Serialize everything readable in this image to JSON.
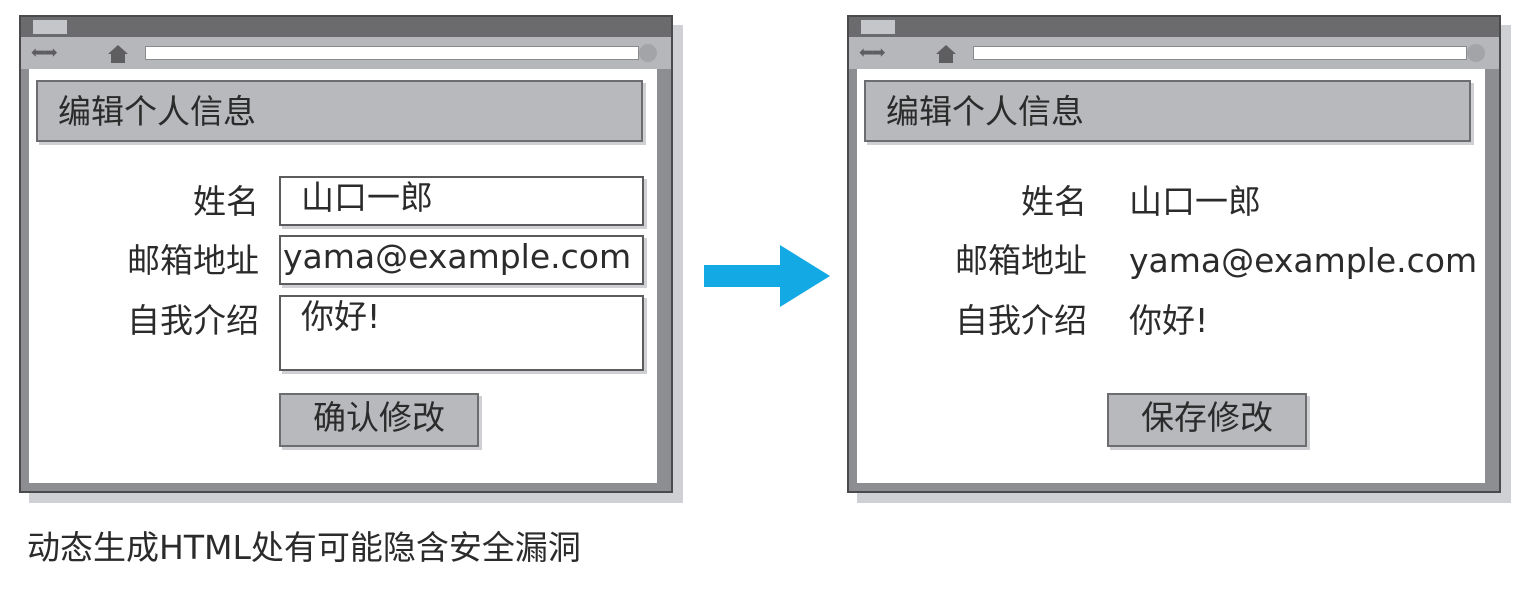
{
  "before": {
    "heading": "编辑个人信息",
    "fields": {
      "name_label": "姓名",
      "name_value": "山口一郎",
      "email_label": "邮箱地址",
      "email_value": "yama@example.com",
      "intro_label": "自我介绍",
      "intro_value": "你好!"
    },
    "submit_label": "确认修改"
  },
  "after": {
    "heading": "编辑个人信息",
    "fields": {
      "name_label": "姓名",
      "name_value": "山口一郎",
      "email_label": "邮箱地址",
      "email_value": "yama@example.com",
      "intro_label": "自我介绍",
      "intro_value": "你好!"
    },
    "save_label": "保存修改"
  },
  "caption": "动态生成HTML处有可能隐含安全漏洞",
  "colors": {
    "arrow": "#12a9e4",
    "window_frame": "#4a4a4c",
    "panel_gray": "#b8b9bd"
  },
  "icons": [
    "back-arrow-icon",
    "forward-arrow-icon",
    "home-icon",
    "right-arrow-icon"
  ]
}
